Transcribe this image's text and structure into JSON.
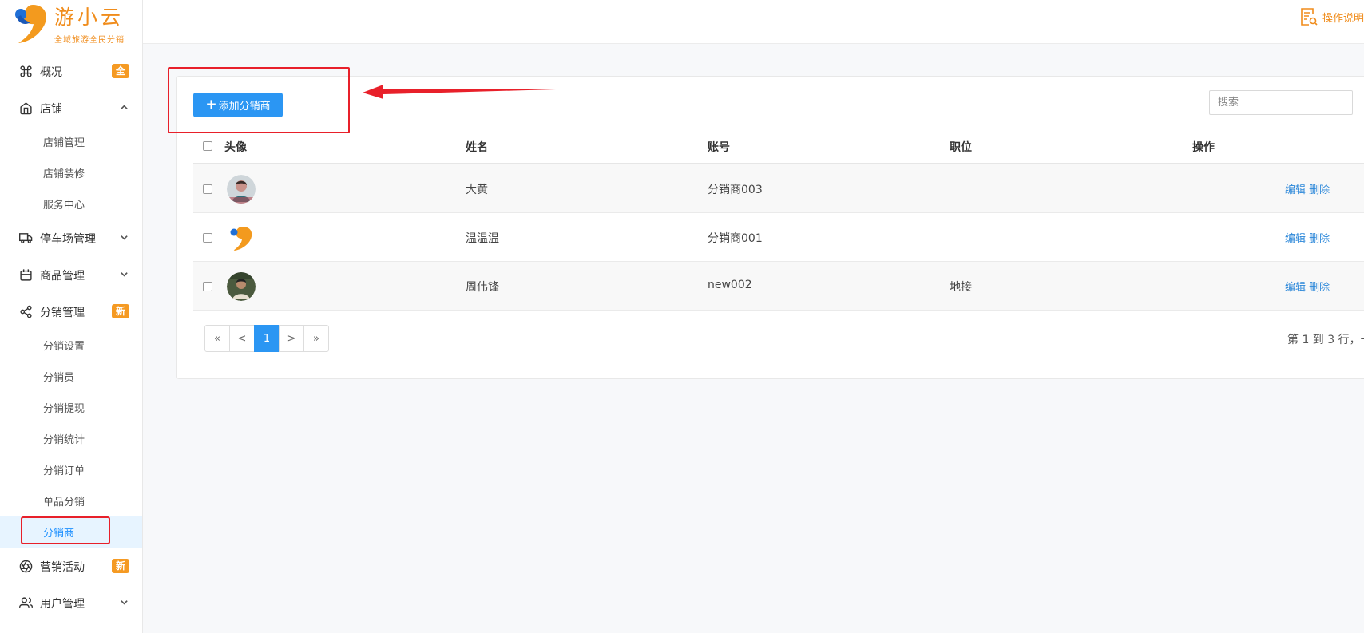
{
  "brand": {
    "name": "游小云",
    "slogan": "全域旅游全民分销"
  },
  "header": {
    "help_label": "操作说明"
  },
  "sidebar": {
    "items": [
      {
        "label": "概况",
        "icon": "command-icon",
        "badge": "全"
      },
      {
        "label": "店铺",
        "icon": "home-icon",
        "expanded": true,
        "children": [
          {
            "label": "店铺管理"
          },
          {
            "label": "店铺装修"
          },
          {
            "label": "服务中心"
          }
        ]
      },
      {
        "label": "停车场管理",
        "icon": "truck-icon"
      },
      {
        "label": "商品管理",
        "icon": "calendar-icon"
      },
      {
        "label": "分销管理",
        "icon": "share-icon",
        "badge": "新",
        "expanded": true,
        "children": [
          {
            "label": "分销设置"
          },
          {
            "label": "分销员"
          },
          {
            "label": "分销提现"
          },
          {
            "label": "分销统计"
          },
          {
            "label": "分销订单"
          },
          {
            "label": "单品分销"
          },
          {
            "label": "分销商",
            "active": true
          }
        ]
      },
      {
        "label": "营销活动",
        "icon": "aperture-icon",
        "badge": "新"
      },
      {
        "label": "用户管理",
        "icon": "users-icon"
      }
    ]
  },
  "main": {
    "add_button_label": "添加分销商",
    "search_placeholder": "搜索",
    "table": {
      "columns": [
        "头像",
        "姓名",
        "账号",
        "职位",
        "操作"
      ],
      "rows": [
        {
          "name": "大黄",
          "account": "分销商003",
          "position": "",
          "edit": "编辑",
          "delete": "删除"
        },
        {
          "name": "温温温",
          "account": "分销商001",
          "position": "",
          "edit": "编辑",
          "delete": "删除"
        },
        {
          "name": "周伟锋",
          "account": "new002",
          "position": "地接",
          "edit": "编辑",
          "delete": "删除"
        }
      ]
    },
    "pagination": {
      "first": "«",
      "prev": "<",
      "current": "1",
      "next": ">",
      "last": "»",
      "info": "第 1 到 3 行，一"
    }
  },
  "colors": {
    "accent": "#2b96f3",
    "brand": "#f08c1b",
    "badge": "#f59a23",
    "annotation": "#e8202a",
    "link": "#2b87d9"
  }
}
